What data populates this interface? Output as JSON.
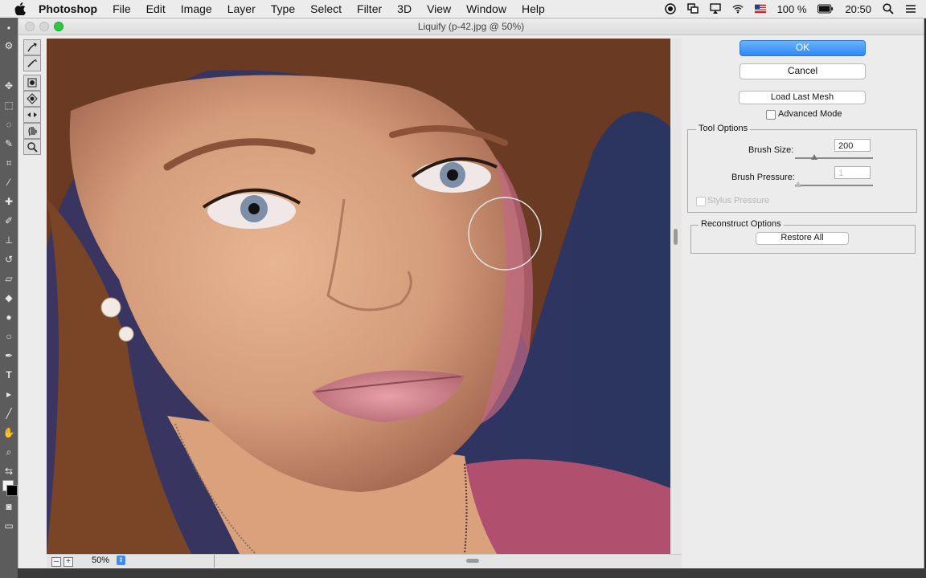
{
  "menubar": {
    "app": "Photoshop",
    "items": [
      "File",
      "Edit",
      "Image",
      "Layer",
      "Type",
      "Select",
      "Filter",
      "3D",
      "View",
      "Window",
      "Help"
    ],
    "battery": "100 %",
    "time": "20:50"
  },
  "window": {
    "title": "Liquify (p-42.jpg @ 50%)"
  },
  "canvas": {
    "zoom": "50%",
    "zoom_out_glyph": "–",
    "zoom_in_glyph": "+"
  },
  "panel": {
    "ok": "OK",
    "cancel": "Cancel",
    "load_last_mesh": "Load Last Mesh",
    "advanced_mode": "Advanced Mode",
    "tool_options": {
      "title": "Tool Options",
      "brush_size_label": "Brush Size:",
      "brush_size": "200",
      "brush_pressure_label": "Brush Pressure:",
      "brush_pressure": "1",
      "stylus_pressure": "Stylus Pressure"
    },
    "reconstruct": {
      "title": "Reconstruct Options",
      "restore_all": "Restore All"
    }
  },
  "icons": {
    "liquify_tools": [
      "forward-warp-icon",
      "reconstruct-icon",
      "pucker-icon",
      "bloat-icon",
      "push-left-icon",
      "hand-icon",
      "zoom-icon"
    ],
    "status": [
      "record-icon",
      "screens-icon",
      "airplay-icon",
      "wifi-icon",
      "flag-icon",
      "battery-icon",
      "search-icon",
      "list-icon"
    ]
  },
  "colors": {
    "accent": "#2f89f5",
    "background": "#2a3560"
  }
}
